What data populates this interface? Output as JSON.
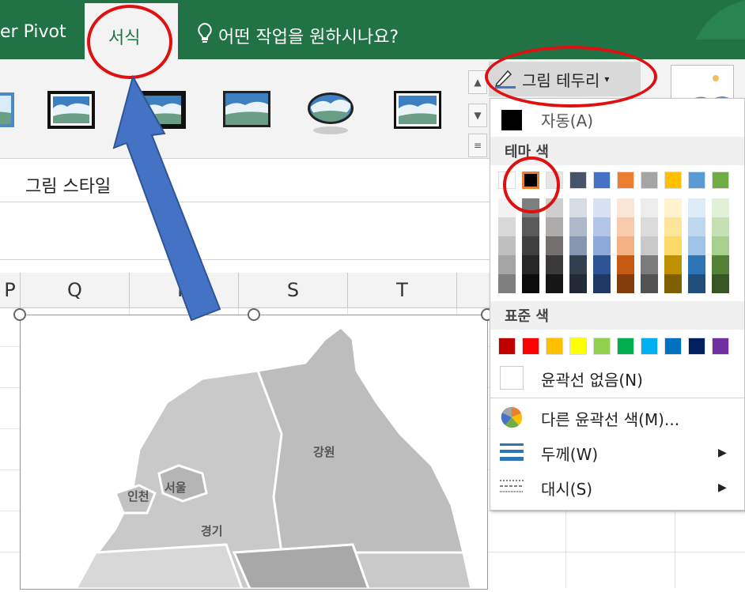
{
  "ribbon": {
    "tab_power_pivot": "er Pivot",
    "tab_format": "서식",
    "tell_me": "어떤 작업을 원하시나요?",
    "group_label": "그림 스타일"
  },
  "columns": [
    "P",
    "Q",
    "R",
    "S",
    "T"
  ],
  "picture_border": {
    "button_label": "그림 테두리",
    "automatic": "자동(A)",
    "theme_colors_title": "테마 색",
    "standard_colors_title": "표준 색",
    "no_outline": "윤곽선 없음(N)",
    "more_colors": "다른 윤곽선 색(M)...",
    "weight": "두께(W)",
    "dashes": "대시(S)",
    "theme_top_row": [
      "#ffffff",
      "#000000",
      "#e7e6e6",
      "#44546a",
      "#4472c4",
      "#ed7d31",
      "#a5a5a5",
      "#ffc000",
      "#5b9bd5",
      "#70ad47"
    ],
    "theme_shades": [
      [
        "#f2f2f2",
        "#7f7f7f",
        "#d0cece",
        "#d6dce4",
        "#d9e2f3",
        "#fbe5d5",
        "#ededed",
        "#fff2cc",
        "#deebf6",
        "#e2efd9"
      ],
      [
        "#d8d8d8",
        "#595959",
        "#aeabab",
        "#adb9ca",
        "#b4c6e7",
        "#f7cbac",
        "#dbdbdb",
        "#fee599",
        "#bdd7ee",
        "#c5e0b3"
      ],
      [
        "#bfbfbf",
        "#3f3f3f",
        "#757070",
        "#8496b0",
        "#8eaadb",
        "#f4b183",
        "#c9c9c9",
        "#ffd965",
        "#9dc3e6",
        "#a8d08d"
      ],
      [
        "#a5a5a5",
        "#262626",
        "#3a3838",
        "#323f4f",
        "#2f5496",
        "#c55a11",
        "#7b7b7b",
        "#bf9000",
        "#2e75b5",
        "#538135"
      ],
      [
        "#7f7f7f",
        "#0c0c0c",
        "#171616",
        "#222a35",
        "#1f3864",
        "#833c0b",
        "#525252",
        "#7f6000",
        "#1e4e79",
        "#375623"
      ]
    ],
    "standard_colors": [
      "#c00000",
      "#ff0000",
      "#ffc000",
      "#ffff00",
      "#92d050",
      "#00b050",
      "#00b0f0",
      "#0070c0",
      "#002060",
      "#7030a0"
    ]
  },
  "map_labels": {
    "gangwon": "강원",
    "incheon": "인천",
    "seoul": "서울",
    "gyeonggi": "경기"
  },
  "annotation_color": "#e01010",
  "arrow_color": "#4472c4"
}
